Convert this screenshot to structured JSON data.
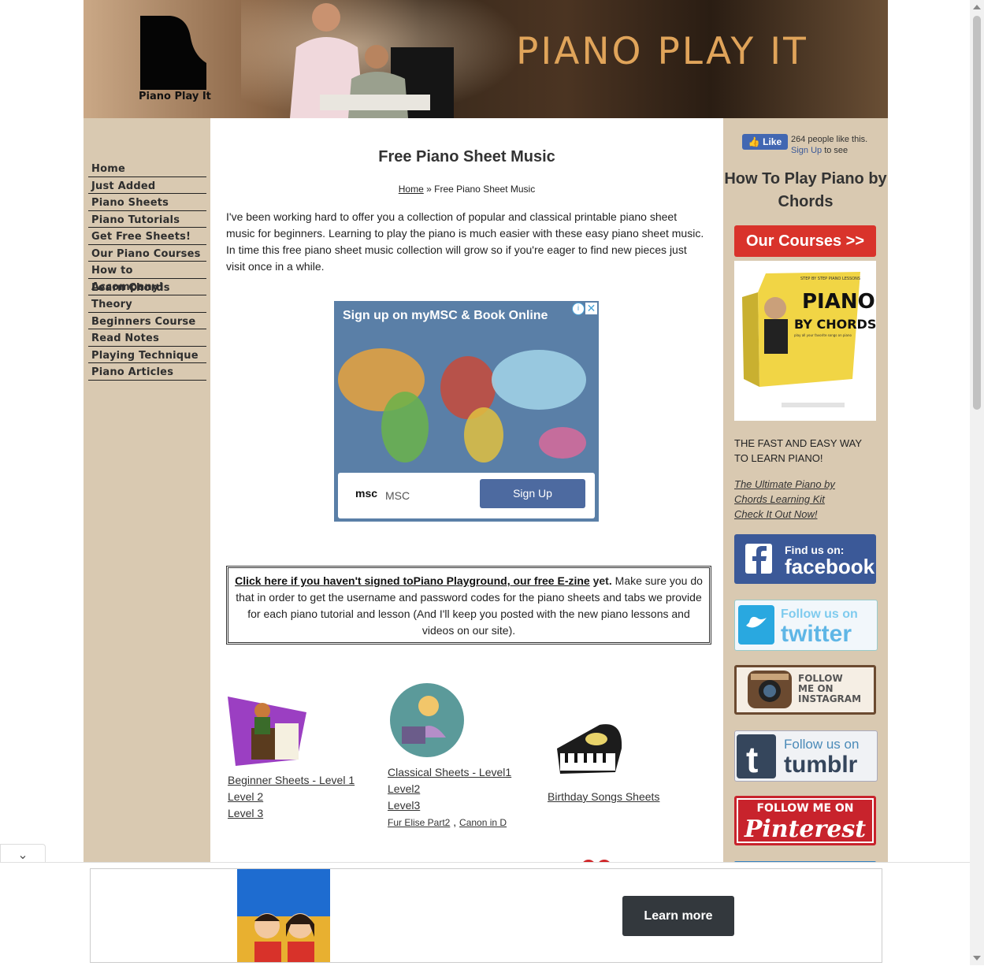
{
  "header": {
    "logo_text": "Piano Play It",
    "site_title": "PIANO PLAY IT"
  },
  "nav": {
    "items": [
      {
        "label": "Home"
      },
      {
        "label": "Just Added"
      },
      {
        "label": "Piano Sheets"
      },
      {
        "label": "Piano Tutorials"
      },
      {
        "label": "Get Free Sheets!"
      },
      {
        "label": "Our Piano Courses"
      },
      {
        "label": "How to Accompany!"
      },
      {
        "label": "Learn Chords"
      },
      {
        "label": "Theory"
      },
      {
        "label": "Beginners Course"
      },
      {
        "label": "Read Notes"
      },
      {
        "label": "Playing Technique"
      },
      {
        "label": "Piano Articles"
      }
    ]
  },
  "main": {
    "title": "Free Piano Sheet Music",
    "breadcrumb": {
      "home": "Home",
      "separator": "»",
      "current": "Free Piano Sheet Music"
    },
    "intro": "I've been working hard to offer you a collection of popular and classical printable piano sheet music for beginners. Learning to play the piano is much easier with these easy piano sheet music. In time this free piano sheet music collection will grow so if you're eager to find new pieces just visit once in a while.",
    "ad": {
      "title": "Sign up on myMSC & Book Online",
      "info": "i",
      "close": "✕",
      "logo": "msc",
      "brand": "MSC",
      "button": "Sign Up"
    },
    "notice": {
      "link": "Click here if you haven't signed toPiano Playground, our free E-zine",
      "bold_after": " yet.",
      "text": " Make sure you do that in order to get the username and password codes for the piano sheets and tabs we provide for each piano tutorial and lesson (And I'll keep you posted with the new piano lessons and videos on our site)."
    },
    "categories": {
      "beginner": {
        "main": "Beginner Sheets - Level 1",
        "l2": "Level 2",
        "l3": "Level 3"
      },
      "classical": {
        "main": "Classical Sheets - Level1",
        "l2": "Level2",
        "l3": "Level3",
        "extra1": "Fur Elise Part2",
        "sep": " , ",
        "extra2": "Canon in D"
      },
      "birthday": {
        "main": "Birthday Songs Sheets"
      }
    }
  },
  "right": {
    "fb_like": "Like",
    "fb_count": "264 people like this.",
    "fb_signup": "Sign Up",
    "fb_signup_suffix": " to see",
    "title": "How To Play Piano by Chords",
    "courses_button": "Our Courses >>",
    "product": {
      "line1": "STEP BY STEP PIANO LESSONS",
      "line2": "PIANO",
      "line3": "BY CHORDS",
      "line4": "play all your favorite songs on piano"
    },
    "tagline": "THE FAST AND EASY WAY TO LEARN PIANO!",
    "link_lines": [
      "The Ultimate Piano by",
      "Chords Learning Kit",
      "Check It Out Now!"
    ],
    "social": {
      "facebook": {
        "top": "Find us on:",
        "name": "facebook"
      },
      "twitter": {
        "top": "Follow us on",
        "name": "twitter"
      },
      "instagram": {
        "l1": "FOLLOW",
        "l2": "ME ON",
        "l3": "INSTAGRAM"
      },
      "tumblr": {
        "top": "Follow us on",
        "name": "tumblr",
        "letter": "t"
      },
      "pinterest": {
        "top": "FOLLOW ME ON",
        "name": "Pinterest"
      }
    }
  },
  "bottom_ad": {
    "button": "Learn more",
    "collapse": "⌄"
  },
  "colors": {
    "sidebar": "#d9c9b1",
    "title_gold": "#e0a45a",
    "courses_red": "#d9332b",
    "facebook": "#3b5998",
    "pinterest": "#c8232c"
  }
}
